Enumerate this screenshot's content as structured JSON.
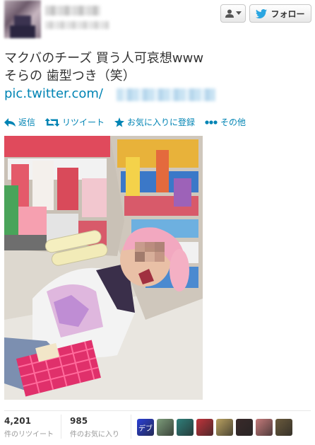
{
  "header": {
    "follow_label": "フォロー"
  },
  "tweet": {
    "line1": "マクバのチーズ 買う人可哀想www",
    "line2": "そらの 歯型つき（笑）",
    "link_prefix": "pic.twitter.com/"
  },
  "actions": {
    "reply": "返信",
    "retweet": "リツイート",
    "favorite": "お気に入りに登録",
    "more": "その他"
  },
  "stats": {
    "retweets_count": "4,201",
    "retweets_label": "件のリツイート",
    "favorites_count": "985",
    "favorites_label": "件のお気に入り"
  },
  "favoriters": [
    {
      "icon": "text-avatar",
      "text": "デブ",
      "color": "#2a3fd6"
    },
    {
      "icon": "character-avatar",
      "text": "",
      "color": "#7c9c7a"
    },
    {
      "icon": "character-avatar",
      "text": "",
      "color": "#2f7f7a"
    },
    {
      "icon": "character-avatar",
      "text": "",
      "color": "#c0343b"
    },
    {
      "icon": "character-avatar",
      "text": "",
      "color": "#b8a060"
    },
    {
      "icon": "character-avatar",
      "text": "",
      "color": "#3a2a2a"
    },
    {
      "icon": "pig-avatar",
      "text": "",
      "color": "#c47a7a"
    },
    {
      "icon": "character-avatar",
      "text": "",
      "color": "#6a5a3c"
    }
  ],
  "colors": {
    "link": "#0084b4",
    "twitter_blue": "#2ba6e1"
  }
}
